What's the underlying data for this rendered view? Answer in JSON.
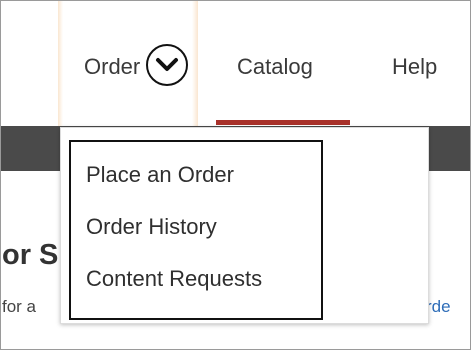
{
  "nav": {
    "order_label": "Order",
    "catalog_label": "Catalog",
    "help_label": "Help",
    "order_icon": "chevron-down-icon",
    "active_underline_color": "#a8312a"
  },
  "dropdown": {
    "items": [
      {
        "label": "Place an Order"
      },
      {
        "label": "Order History"
      },
      {
        "label": "Content Requests"
      }
    ]
  },
  "page": {
    "heading_fragment": "or S",
    "body_fragment": "for a",
    "link_fragment": "rde"
  },
  "colors": {
    "banner": "#4a4a4a",
    "link": "#2e6db8",
    "annotation": "#111111"
  }
}
